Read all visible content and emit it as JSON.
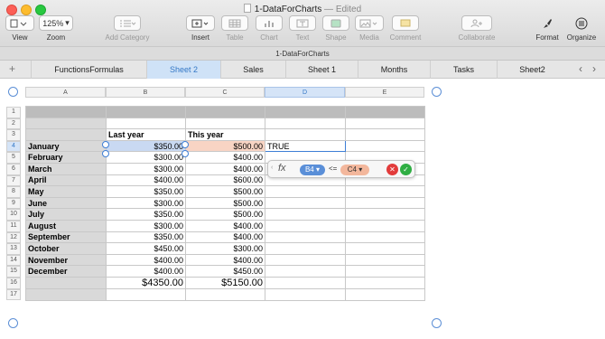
{
  "window": {
    "title": "1-DataForCharts",
    "status": "— Edited"
  },
  "toolbar": {
    "view": {
      "label": "View"
    },
    "zoom": {
      "label": "Zoom",
      "value": "125%"
    },
    "add_category": {
      "label": "Add Category"
    },
    "insert": {
      "label": "Insert"
    },
    "table": {
      "label": "Table"
    },
    "chart": {
      "label": "Chart"
    },
    "text": {
      "label": "Text"
    },
    "shape": {
      "label": "Shape"
    },
    "media": {
      "label": "Media"
    },
    "comment": {
      "label": "Comment"
    },
    "collaborate": {
      "label": "Collaborate"
    },
    "format": {
      "label": "Format"
    },
    "organize": {
      "label": "Organize"
    }
  },
  "document_tab": "1-DataForCharts",
  "sheets": [
    "FunctionsFormulas",
    "Sheet 2",
    "Sales",
    "Sheet 1",
    "Months",
    "Tasks",
    "Sheet2"
  ],
  "active_sheet": "Sheet 2",
  "columns": [
    "A",
    "B",
    "C",
    "D",
    "E"
  ],
  "selected_column": "D",
  "rows": [
    "1",
    "2",
    "3",
    "4",
    "5",
    "6",
    "7",
    "8",
    "9",
    "10",
    "11",
    "12",
    "13",
    "14",
    "15",
    "16",
    "17"
  ],
  "selected_row": "4",
  "table": {
    "header_b": "Last year",
    "header_c": "This year",
    "months": [
      "January",
      "February",
      "March",
      "April",
      "May",
      "June",
      "July",
      "August",
      "September",
      "October",
      "November",
      "December"
    ],
    "last_year": [
      "$350.00",
      "$300.00",
      "$300.00",
      "$400.00",
      "$350.00",
      "$300.00",
      "$350.00",
      "$300.00",
      "$350.00",
      "$450.00",
      "$400.00",
      "$400.00"
    ],
    "this_year": [
      "$500.00",
      "$400.00",
      "$400.00",
      "$600.00",
      "$500.00",
      "$500.00",
      "$500.00",
      "$400.00",
      "$400.00",
      "$300.00",
      "$400.00",
      "$450.00"
    ],
    "total_last": "$4350.00",
    "total_this": "$5150.00",
    "d4_value": "TRUE"
  },
  "formula": {
    "fx": "fx",
    "ref1": "B4",
    "operator": "<=",
    "ref2": "C4"
  },
  "colors": {
    "accent": "#3478c6",
    "cancel": "#e23b3b",
    "accept": "#2fae43"
  }
}
